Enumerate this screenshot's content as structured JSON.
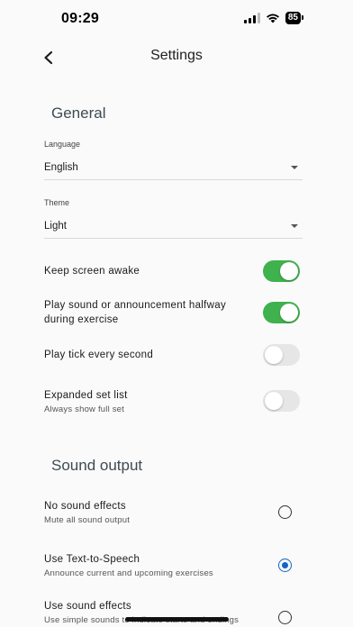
{
  "status_bar": {
    "time": "09:29",
    "battery": "85"
  },
  "header": {
    "title": "Settings"
  },
  "general": {
    "title": "General",
    "language": {
      "label": "Language",
      "value": "English"
    },
    "theme": {
      "label": "Theme",
      "value": "Light"
    },
    "toggles": [
      {
        "label": "Keep screen awake",
        "on": true
      },
      {
        "label": "Play sound or announcement halfway during exercise",
        "on": true
      },
      {
        "label": "Play tick every second",
        "on": false
      },
      {
        "label": "Expanded set list",
        "sublabel": "Always show full set",
        "on": false
      }
    ]
  },
  "sound_output": {
    "title": "Sound output",
    "options": [
      {
        "label": "No sound effects",
        "sublabel": "Mute all sound output",
        "selected": false
      },
      {
        "label": "Use Text-to-Speech",
        "sublabel": "Announce current and upcoming exercises",
        "selected": true
      },
      {
        "label": "Use sound effects",
        "sublabel": "Use simple sounds to indicate starts and endings",
        "selected": false
      }
    ]
  },
  "colors": {
    "toggle_on": "#3fb14d",
    "radio_selected": "#1565c0",
    "background": "#fafafa"
  },
  "icons": {
    "back": "chevron-left-icon",
    "dropdown": "caret-down-icon"
  }
}
